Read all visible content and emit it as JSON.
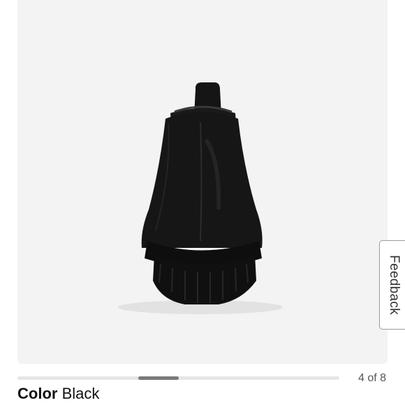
{
  "product_image": {
    "alt": "Black Chelsea boot, back view",
    "background": "#f3f3f3",
    "boot_color": "#141414"
  },
  "feedback": {
    "label": "Feedback"
  },
  "carousel": {
    "counter": "4 of 8",
    "current": 4,
    "total": 8
  },
  "color": {
    "label": "Color",
    "value": "Black"
  }
}
